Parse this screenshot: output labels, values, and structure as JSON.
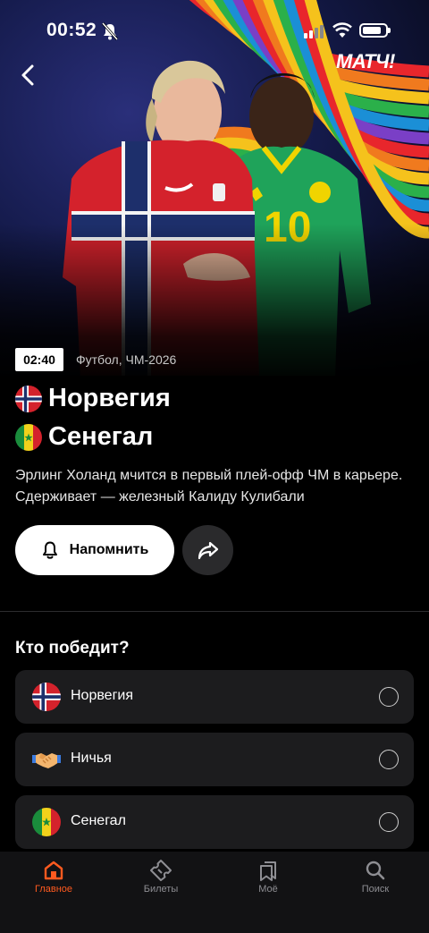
{
  "status_bar": {
    "time": "00:52"
  },
  "header": {
    "logo": "МАТЧ!"
  },
  "match": {
    "time_badge": "02:40",
    "meta": "Футбол, ЧМ-2026",
    "team1": "Норвегия",
    "team2": "Сенегал",
    "description": "Эрлинг Холанд мчится в первый плей-офф ЧМ в карьере. Сдерживает — железный Калиду Кулибали",
    "jersey_number": "10"
  },
  "actions": {
    "remind_label": "Напомнить"
  },
  "poll": {
    "title": "Кто победит?",
    "options": [
      {
        "label": "Норвегия",
        "icon": "norway-flag-icon"
      },
      {
        "label": "Ничья",
        "icon": "handshake-icon"
      },
      {
        "label": "Сенегал",
        "icon": "senegal-flag-icon"
      }
    ]
  },
  "tabbar": {
    "tabs": [
      {
        "label": "Главное",
        "icon": "home-icon",
        "active": true
      },
      {
        "label": "Билеты",
        "icon": "ticket-icon",
        "active": false
      },
      {
        "label": "Моё",
        "icon": "bookmark-icon",
        "active": false
      },
      {
        "label": "Поиск",
        "icon": "search-icon",
        "active": false
      }
    ]
  },
  "colors": {
    "accent": "#ff5a1f",
    "card": "#1c1c1e",
    "background": "#000000"
  }
}
